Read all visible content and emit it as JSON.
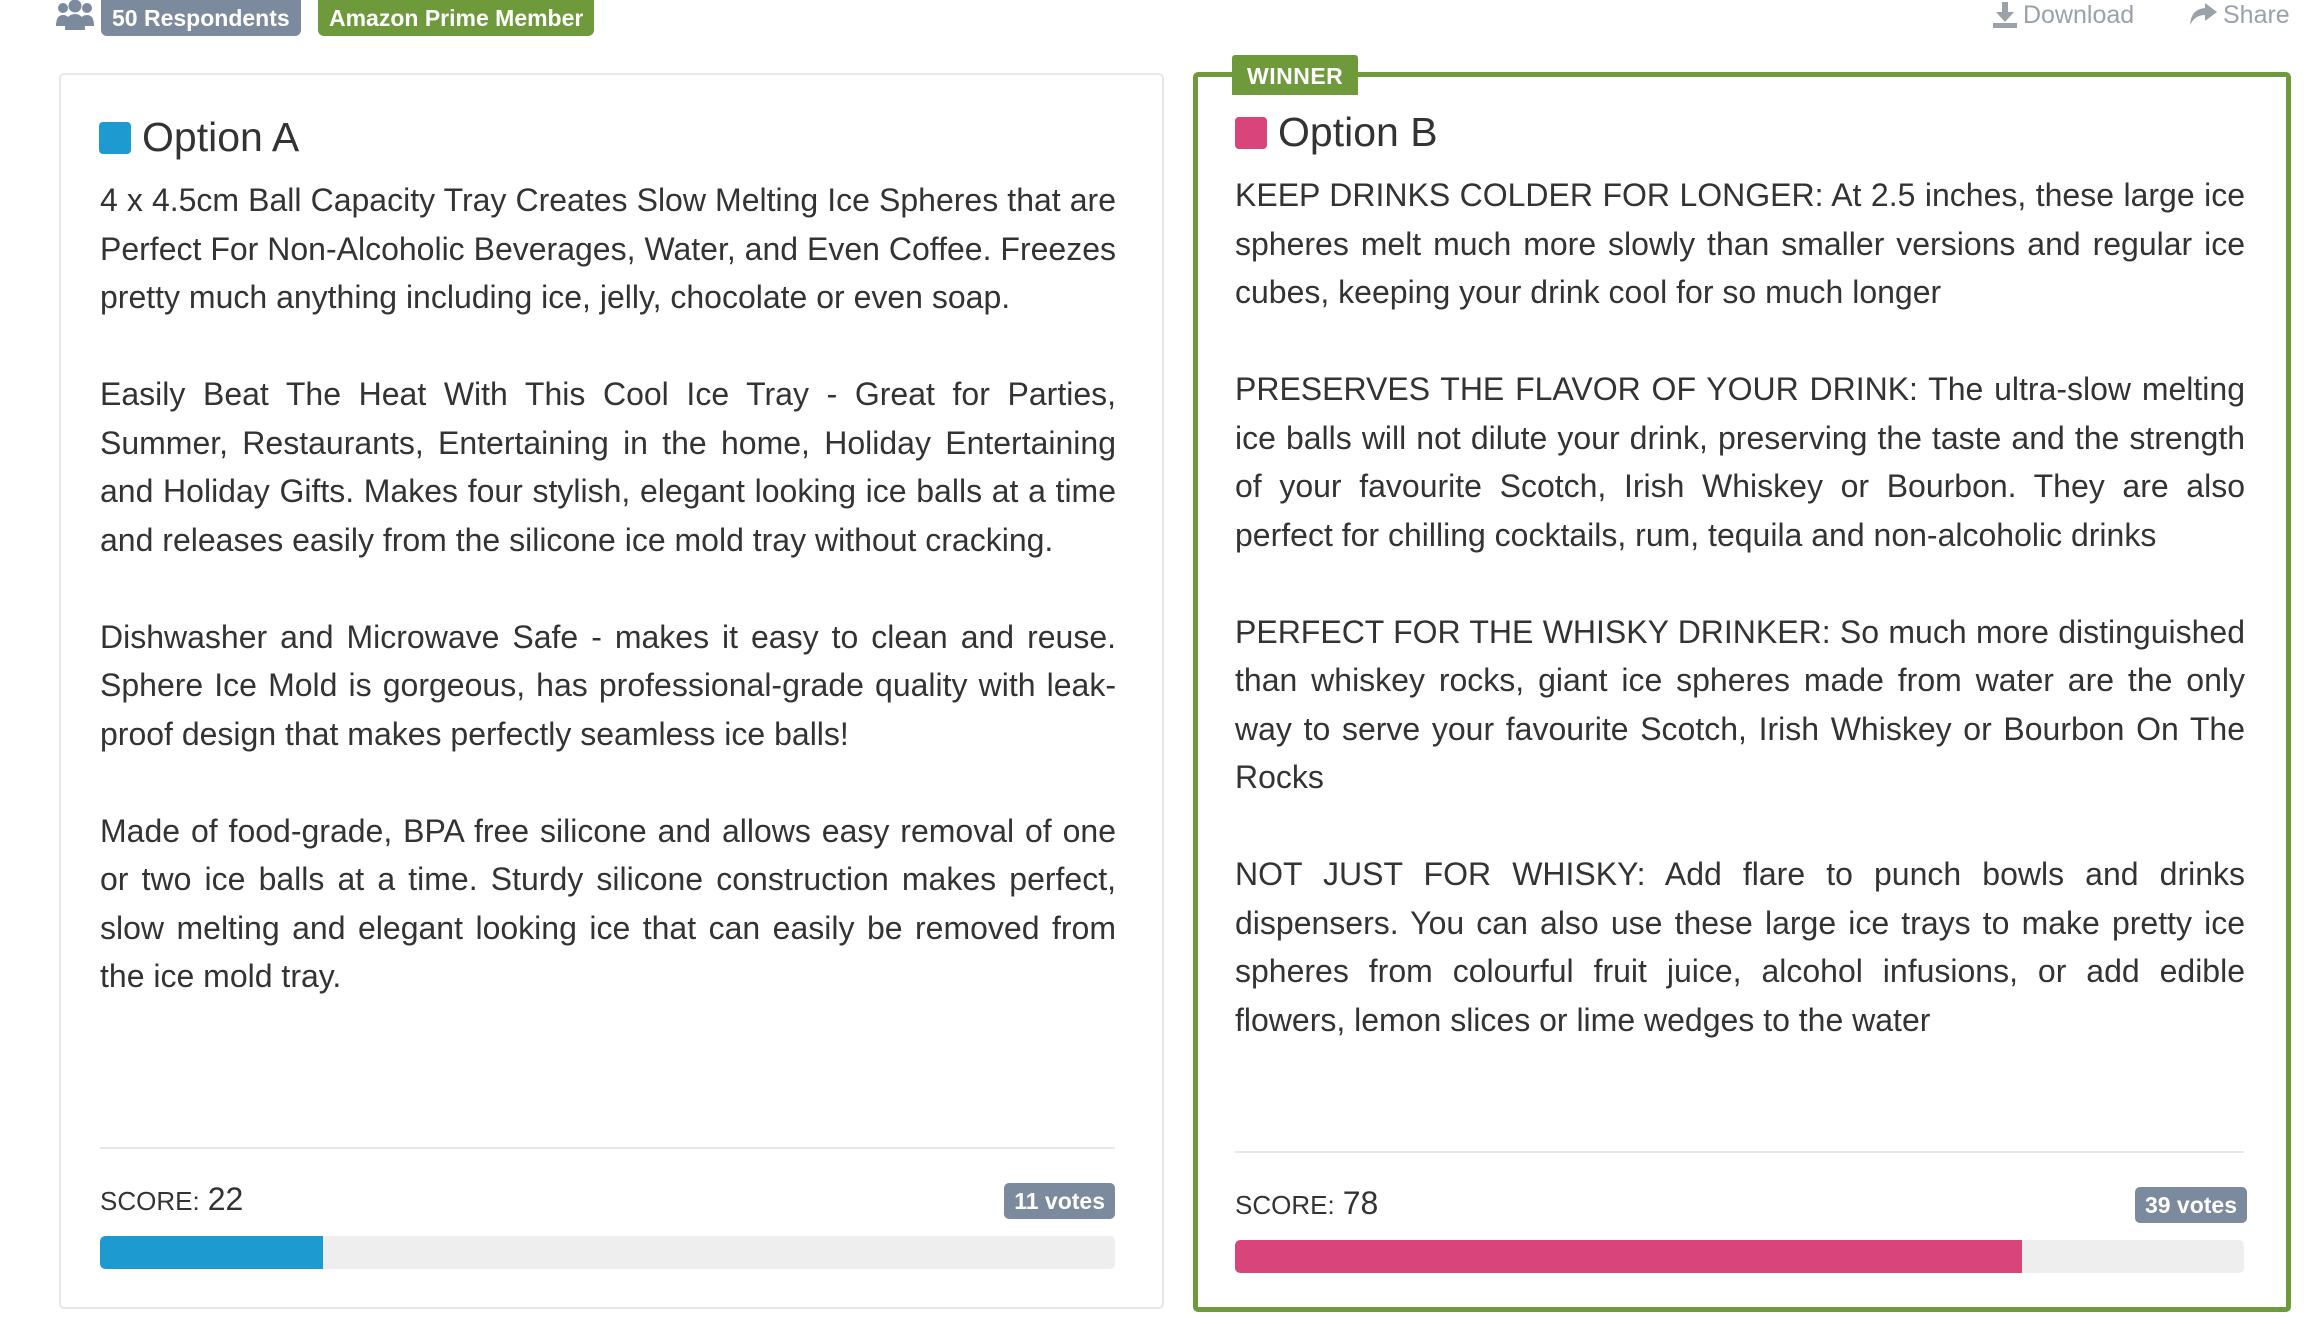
{
  "topbar": {
    "respondents_icon": "users-icon",
    "respondents_badge": "50 Respondents",
    "prime_badge": "Amazon Prime Member",
    "download_icon": "download-icon",
    "download_label": "Download",
    "share_icon": "share-icon",
    "share_label": "Share"
  },
  "colors": {
    "option_a": "#1d9bd1",
    "option_b": "#d9447a",
    "winner_green": "#6e9a3c",
    "badge_gray": "#7b8a9d"
  },
  "option_a": {
    "title": "Option A",
    "paragraphs": [
      "4 x 4.5cm Ball Capacity Tray Creates Slow Melting Ice Spheres that are Perfect For Non-Alcoholic Beverages, Water, and Even Coffee. Freezes pretty much anything including ice, jelly, chocolate or even soap.",
      "Easily Beat The Heat With This Cool Ice Tray - Great for Parties, Summer, Restaurants, Entertaining in the home, Holiday Entertaining and Holiday Gifts. Makes four stylish, elegant looking ice balls at a time and releases easily from the silicone ice mold tray without cracking.",
      "Dishwasher and Microwave Safe - makes it easy to clean and reuse. Sphere Ice Mold is gorgeous, has professional-grade quality with leak-proof design that makes perfectly seamless ice balls!",
      "Made of food-grade, BPA free silicone and allows easy removal of one or two ice balls at a time. Sturdy silicone construction makes perfect, slow melting and elegant looking ice that can easily be removed from the ice mold tray."
    ],
    "score_label": "SCORE:",
    "score": "22",
    "score_percent": 22,
    "votes": "11 votes"
  },
  "option_b": {
    "winner_label": "WINNER",
    "title": "Option B",
    "paragraphs": [
      "KEEP DRINKS COLDER FOR LONGER: At 2.5 inches, these large ice spheres melt much more slowly than smaller versions and regular ice cubes, keeping your drink cool for so much longer",
      "PRESERVES THE FLAVOR OF YOUR DRINK: The ultra-slow melting ice balls will not dilute your drink, preserving the taste and the strength of your favourite Scotch, Irish Whiskey or Bourbon. They are also perfect for chilling cocktails, rum, tequila and non-alcoholic drinks",
      "PERFECT FOR THE WHISKY DRINKER: So much more distinguished than whiskey rocks, giant ice spheres made from water are the only way to serve your favourite Scotch, Irish Whiskey or Bourbon On The Rocks",
      "NOT JUST FOR WHISKY: Add flare to punch bowls and drinks dispensers. You can also use these large ice trays to make pretty ice spheres from colourful fruit juice, alcohol infusions, or add edible flowers, lemon slices or lime wedges to the water"
    ],
    "score_label": "SCORE:",
    "score": "78",
    "score_percent": 78,
    "votes": "39 votes"
  }
}
